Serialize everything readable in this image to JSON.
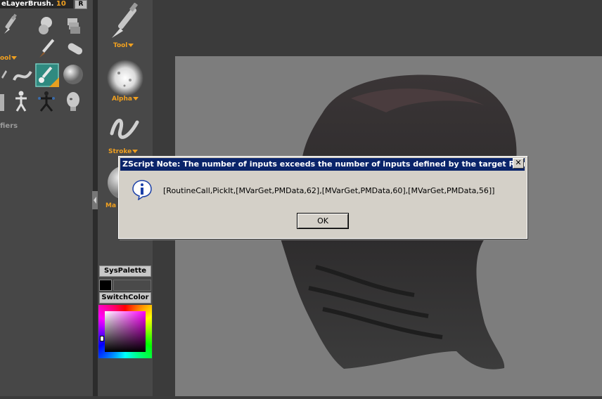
{
  "tool_panel": {
    "header_title": "eLayerBrush.",
    "header_number": "10",
    "r_button": "R",
    "tool_label": "ool",
    "modifiers_label": "fiers"
  },
  "mid_panel": {
    "tool_label": "Tool",
    "alpha_label": "Alpha",
    "stroke_label": "Stroke",
    "material_label": "Ma",
    "syspalette_label": "SysPalette",
    "switchcolor_label": "SwitchColor"
  },
  "dialog": {
    "title": "ZScript Note: The number of inputs exceeds the number of inputs defined by the target Routine.",
    "close_glyph": "✕",
    "message": "[RoutineCall,PickIt,[MVarGet,PMData,62],[MVarGet,PMData,60],[MVarGet,PMData,56]]",
    "ok_label": "OK",
    "icon": "info-icon"
  },
  "colors": {
    "accent_orange": "#f0a020",
    "dialog_title_bg": "#0a246a",
    "dialog_bg": "#d4d0c8",
    "canvas_bg": "#7d7d7d"
  }
}
